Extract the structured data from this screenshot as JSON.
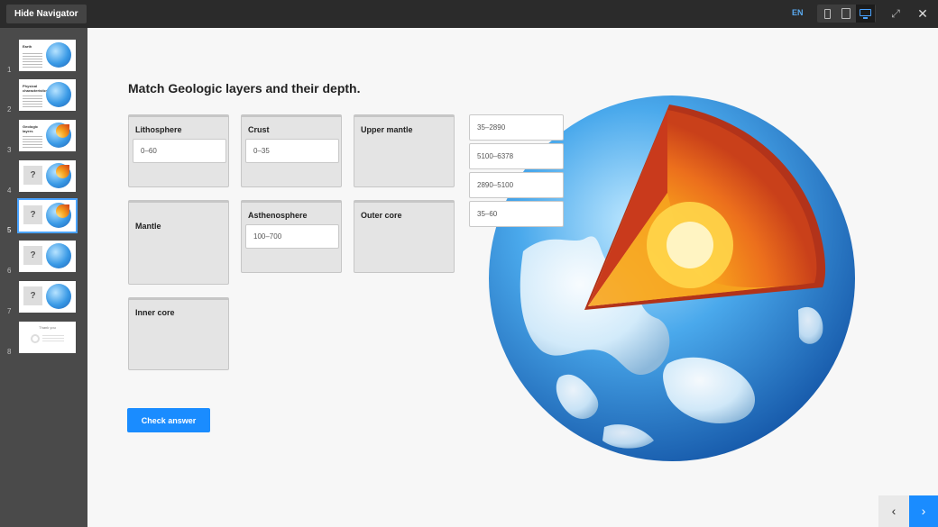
{
  "topbar": {
    "hide_navigator": "Hide Navigator",
    "language": "EN",
    "close": "✕",
    "expand": "⤢"
  },
  "navigator": {
    "items": [
      {
        "num": "1",
        "thumb_title": "Earth"
      },
      {
        "num": "2",
        "thumb_title": "Physical characteristics"
      },
      {
        "num": "3",
        "thumb_title": "Geologic layers"
      },
      {
        "num": "4",
        "thumb_title": "?"
      },
      {
        "num": "5",
        "thumb_title": "?"
      },
      {
        "num": "6",
        "thumb_title": "?"
      },
      {
        "num": "7",
        "thumb_title": "?"
      },
      {
        "num": "8",
        "thumb_title": "Thank you"
      }
    ],
    "active": 5
  },
  "question": {
    "title": "Match Geologic layers and their depth."
  },
  "dropzones": [
    {
      "label": "Lithosphere",
      "answer": "0–60"
    },
    {
      "label": "Crust",
      "answer": "0–35"
    },
    {
      "label": "Upper mantle",
      "answer": ""
    },
    {
      "label": "Mantle",
      "answer": ""
    },
    {
      "label": "Asthenosphere",
      "answer": "100–700"
    },
    {
      "label": "Outer core",
      "answer": ""
    },
    {
      "label": "Inner core",
      "answer": ""
    }
  ],
  "bank": [
    "35–2890",
    "5100–6378",
    "2890–5100",
    "35–60"
  ],
  "check_answer": "Check answer",
  "nav_buttons": {
    "prev": "‹",
    "next": "›"
  },
  "colors": {
    "accent": "#1a8cff",
    "topbar": "#2b2b2b",
    "navigator": "#4a4a4a"
  }
}
